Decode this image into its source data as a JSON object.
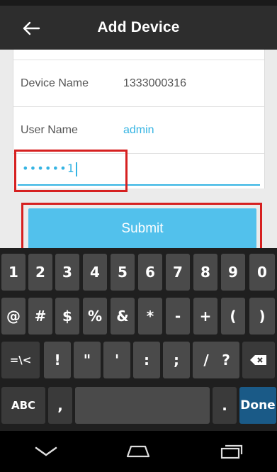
{
  "header": {
    "title": "Add Device",
    "back_icon": "arrow-left-icon"
  },
  "form": {
    "device_name_label": "Device Name",
    "device_name_value": "1333000316",
    "user_name_label": "User Name",
    "user_name_value": "admin",
    "password_value": "••••••1"
  },
  "submit_label": "Submit",
  "keyboard": {
    "row1": [
      "1",
      "2",
      "3",
      "4",
      "5",
      "6",
      "7",
      "8",
      "9",
      "0"
    ],
    "row2": [
      "@",
      "#",
      "$",
      "%",
      "&",
      "*",
      "-",
      "+",
      "(",
      ")"
    ],
    "row3": [
      "=\\<",
      "!",
      "\"",
      "'",
      ":",
      ";",
      "/",
      "?",
      "⌫"
    ],
    "row4": {
      "abc": "ABC",
      "comma": ",",
      "space": "",
      "period": ".",
      "done": "Done"
    }
  },
  "colors": {
    "accent": "#35b4e3",
    "submit_bg": "#52c1ec",
    "highlight": "#d62020"
  }
}
